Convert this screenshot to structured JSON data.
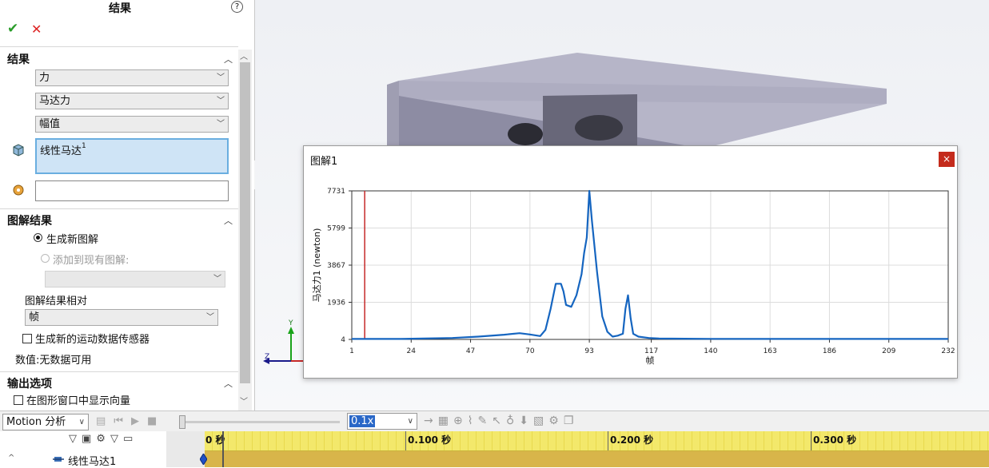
{
  "panel": {
    "title": "结果",
    "help_glyph": "?",
    "ok_glyph": "✔",
    "cancel_glyph": "✕",
    "results_section": {
      "label": "结果",
      "category": "力",
      "subcategory": "马达力",
      "component": "幅值",
      "selected_item": "线性马达",
      "selected_item_suffix": "1",
      "reference_field": ""
    },
    "plot_section": {
      "label": "图解结果",
      "radio_new": "生成新图解",
      "radio_existing": "添加到现有图解:",
      "existing_select": "",
      "relative_label": "图解结果相对",
      "relative_value": "帧",
      "sensor_checkbox": "生成新的运动数据传感器",
      "value_text": "数值:无数据可用"
    },
    "output_section": {
      "label": "输出选项",
      "vector_checkbox": "在图形窗口中显示向量"
    }
  },
  "graph": {
    "title": "图解1",
    "close_glyph": "×"
  },
  "chart_data": {
    "type": "line",
    "xlabel": "帧",
    "ylabel": "马达力1 (newton)",
    "xlim": [
      1,
      232
    ],
    "ylim": [
      4,
      7731
    ],
    "x_ticks": [
      "1",
      "24",
      "47",
      "70",
      "93",
      "117",
      "140",
      "163",
      "186",
      "209",
      "232"
    ],
    "y_ticks": [
      "4",
      "1936",
      "3867",
      "5799",
      "7731"
    ],
    "grid": true,
    "series_color": "#1565c0",
    "marker_color": "#c62828",
    "marker_x": 6,
    "series": [
      {
        "x": [
          1,
          20,
          40,
          50,
          60,
          66,
          70,
          74,
          76,
          78,
          80,
          82,
          83,
          84,
          86,
          88,
          90,
          91,
          92,
          93,
          94,
          96,
          98,
          100,
          102,
          104,
          106,
          107,
          108,
          109,
          110,
          112,
          116,
          120,
          130,
          140,
          160,
          180,
          200,
          220,
          232
        ],
        "y": [
          30,
          30,
          80,
          150,
          250,
          330,
          260,
          180,
          500,
          1600,
          2900,
          2900,
          2500,
          1800,
          1700,
          2300,
          3400,
          4500,
          5300,
          7731,
          6200,
          3500,
          1200,
          400,
          150,
          200,
          300,
          1600,
          2300,
          1100,
          300,
          150,
          80,
          50,
          40,
          35,
          30,
          30,
          30,
          30,
          30
        ]
      }
    ]
  },
  "motionbar": {
    "study_type": "Motion 分析",
    "playback_speed": "0.1x",
    "dropdown_glyph": "∨"
  },
  "timeline": {
    "time_labels": [
      "0 秒",
      "0.100 秒",
      "0.200 秒",
      "0.300 秒"
    ],
    "row_item": "线性马达1",
    "expand_glyph": "^"
  },
  "colors": {
    "model_top": "#b6b5c8",
    "model_side": "#8d8ca3",
    "timeline_stripe": "#f3e86b",
    "timeline_bar": "#d8b54a",
    "listbox_fill": "#cfe4f6"
  }
}
